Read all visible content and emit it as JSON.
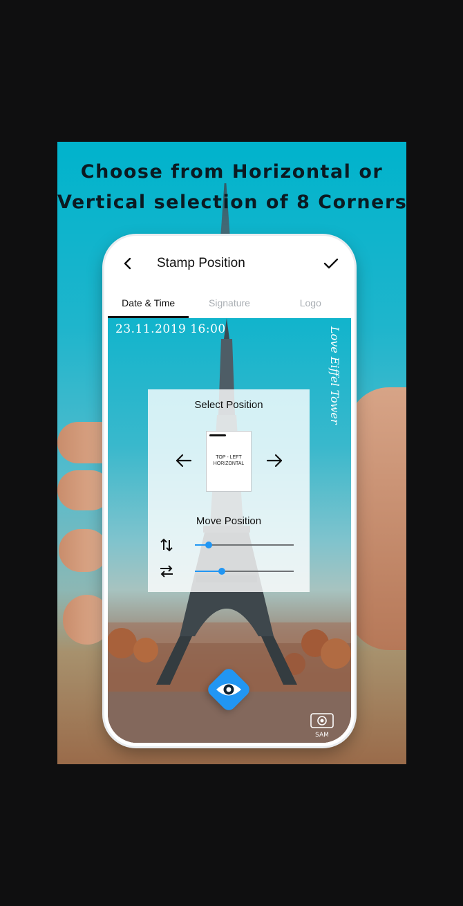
{
  "promo": {
    "headline_line1": "Choose from Horizontal or",
    "headline_line2": "Vertical selection of 8 Corners"
  },
  "appbar": {
    "title": "Stamp Position",
    "back_icon": "chevron-left-icon",
    "confirm_icon": "check-icon"
  },
  "tabs": [
    {
      "label": "Date & Time",
      "active": true
    },
    {
      "label": "Signature",
      "active": false
    },
    {
      "label": "Logo",
      "active": false
    }
  ],
  "photo": {
    "date_stamp": "23.11.2019 16:00",
    "signature_stamp": "Love Eiffel Tower"
  },
  "panel": {
    "title": "Select Position",
    "preview_line1": "TOP - LEFT",
    "preview_line2": "HORIZONTAL",
    "move_title": "Move Position",
    "vertical_slider_value": 0.14,
    "horizontal_slider_value": 0.27
  },
  "fab": {
    "icon": "eye-icon"
  },
  "logo": {
    "text": "SAM"
  },
  "colors": {
    "accent": "#2196f3",
    "background": "#0f0f10",
    "sky": "#00b3cc"
  }
}
